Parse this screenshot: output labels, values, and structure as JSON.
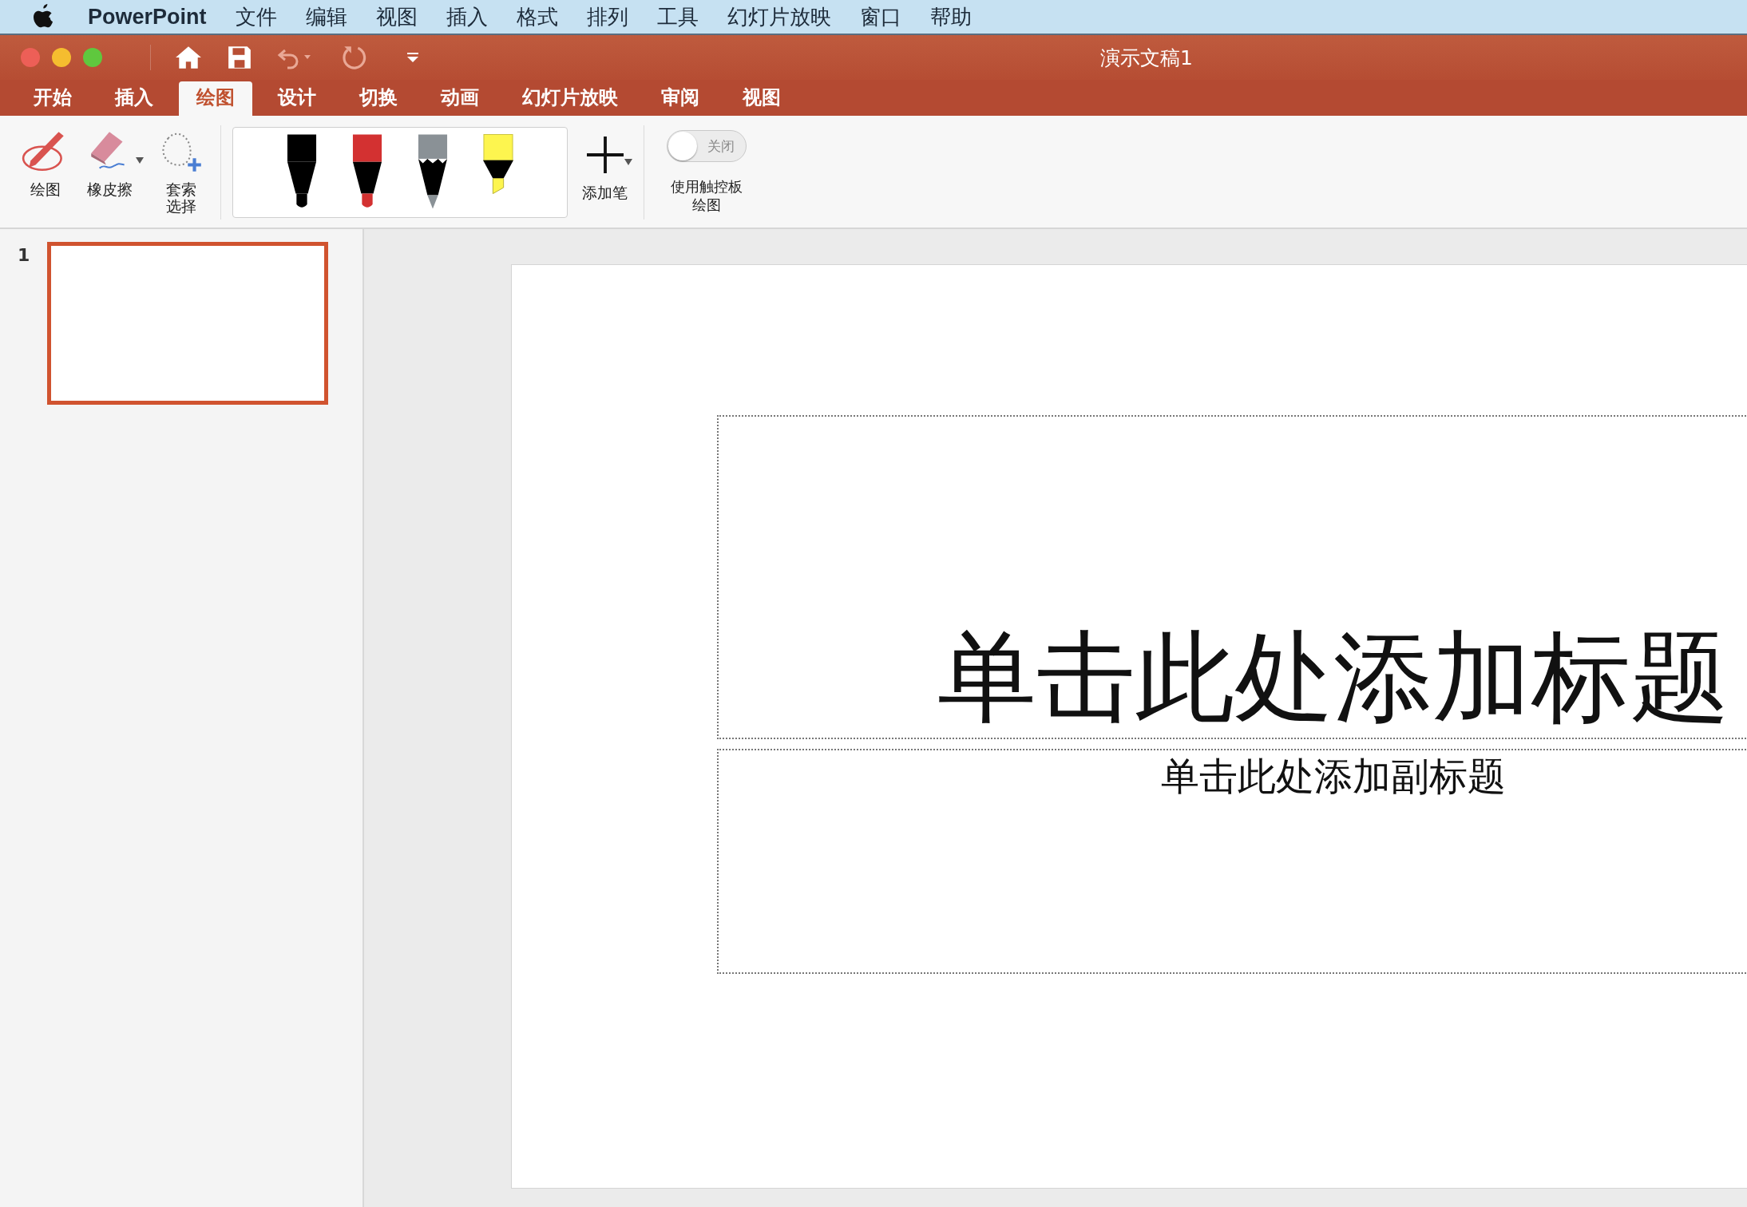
{
  "menu_bar": {
    "app_name": "PowerPoint",
    "items": [
      "文件",
      "编辑",
      "视图",
      "插入",
      "格式",
      "排列",
      "工具",
      "幻灯片放映",
      "窗口",
      "帮助"
    ]
  },
  "window": {
    "title": "演示文稿1"
  },
  "tabs": [
    {
      "label": "开始",
      "selected": false
    },
    {
      "label": "插入",
      "selected": false
    },
    {
      "label": "绘图",
      "selected": true
    },
    {
      "label": "设计",
      "selected": false
    },
    {
      "label": "切换",
      "selected": false
    },
    {
      "label": "动画",
      "selected": false
    },
    {
      "label": "幻灯片放映",
      "selected": false
    },
    {
      "label": "审阅",
      "selected": false
    },
    {
      "label": "视图",
      "selected": false
    }
  ],
  "ribbon": {
    "tools": [
      {
        "kind": "draw",
        "label": "绘图"
      },
      {
        "kind": "eraser",
        "label": "橡皮擦"
      },
      {
        "kind": "lasso",
        "label": "套索选择"
      }
    ],
    "pens": [
      {
        "kind": "pen",
        "color": "#000000"
      },
      {
        "kind": "pen",
        "color": "#d33131"
      },
      {
        "kind": "pencil",
        "color": "#8a9196"
      },
      {
        "kind": "highlighter",
        "color": "#fdf54f"
      }
    ],
    "add_pen": "添加笔",
    "trackpad_toggle": {
      "label": "关闭",
      "on": false
    },
    "trackpad_caption": "使用触控板绘图"
  },
  "slides_panel": {
    "thumbnails": [
      {
        "number": "1",
        "selected": true
      }
    ]
  },
  "slide": {
    "title_placeholder": "单击此处添加标题",
    "subtitle_placeholder": "单击此处添加副标题"
  }
}
